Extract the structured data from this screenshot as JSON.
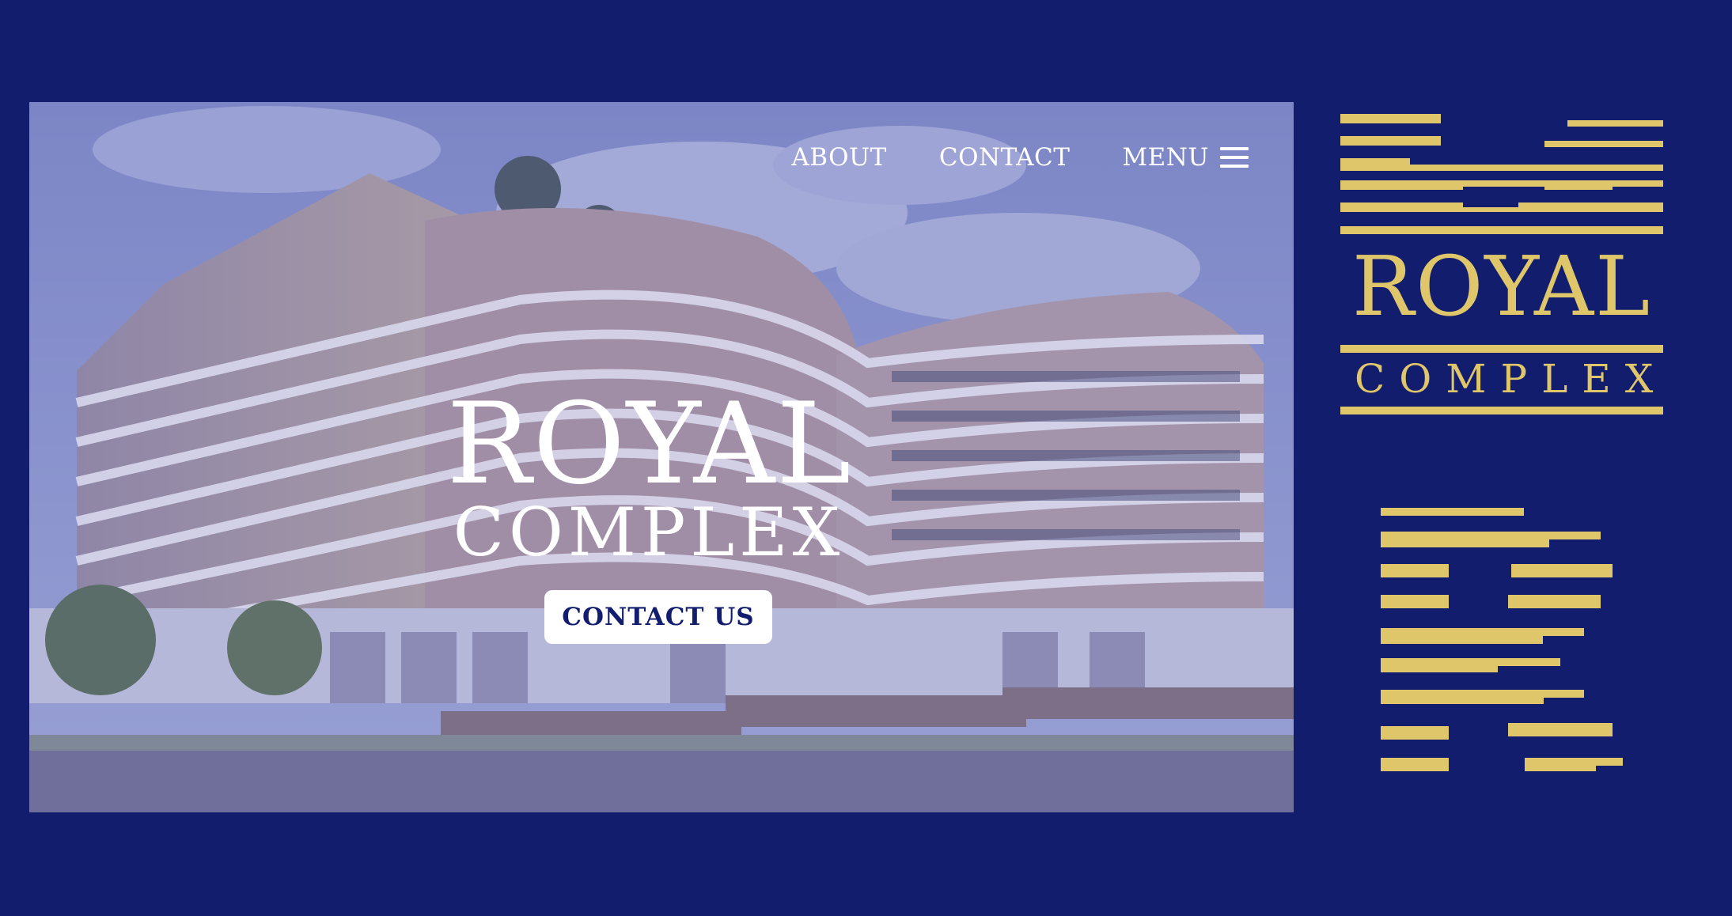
{
  "nav": {
    "about": "ABOUT",
    "contact": "CONTACT",
    "menu": "MENU",
    "menu_icon": "hamburger-icon"
  },
  "hero": {
    "title": "ROYAL",
    "subtitle": "COMPLEX",
    "cta": "CONTACT US"
  },
  "logo": {
    "title": "ROYAL",
    "subtitle": "COMPLEX"
  },
  "colors": {
    "background": "#131d6e",
    "gold": "#e0c66a",
    "white": "#ffffff"
  }
}
